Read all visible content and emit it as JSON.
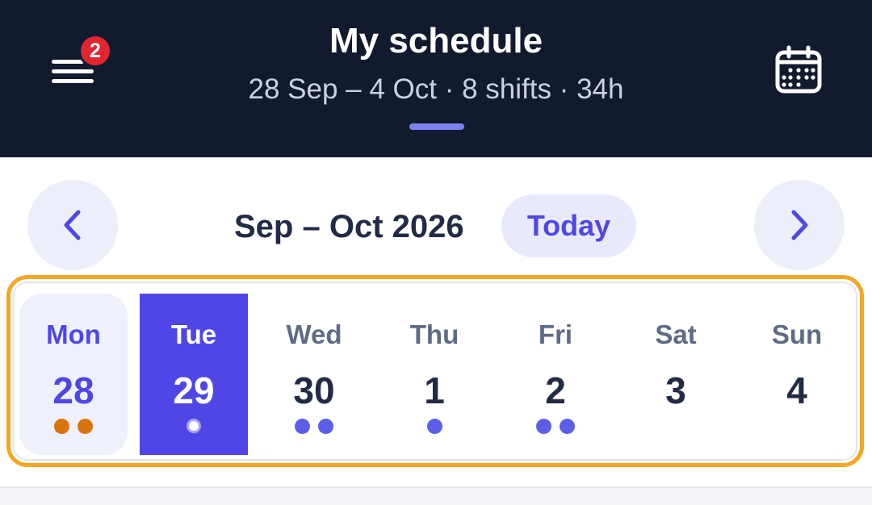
{
  "header": {
    "title": "My schedule",
    "subtitle": "28 Sep – 4 Oct · 8 shifts · 34h",
    "menu_icon": "menu-icon",
    "notification_count": "2",
    "calendar_icon": "calendar-icon"
  },
  "nav": {
    "month_label": "Sep – Oct 2026",
    "today_label": "Today",
    "prev_icon": "chevron-left-icon",
    "next_icon": "chevron-right-icon"
  },
  "week": {
    "days": [
      {
        "name": "Mon",
        "date": "28",
        "state": "today",
        "dots": [
          "amber",
          "amber"
        ]
      },
      {
        "name": "Tue",
        "date": "29",
        "state": "selected",
        "dots": [
          "white"
        ]
      },
      {
        "name": "Wed",
        "date": "30",
        "state": "normal",
        "dots": [
          "blue",
          "blue"
        ]
      },
      {
        "name": "Thu",
        "date": "1",
        "state": "normal",
        "dots": [
          "blue"
        ]
      },
      {
        "name": "Fri",
        "date": "2",
        "state": "normal",
        "dots": [
          "blue",
          "blue"
        ]
      },
      {
        "name": "Sat",
        "date": "3",
        "state": "normal",
        "dots": []
      },
      {
        "name": "Sun",
        "date": "4",
        "state": "normal",
        "dots": []
      }
    ]
  },
  "colors": {
    "header_bg": "#121a2e",
    "accent": "#4f46e5",
    "highlight_border": "#f5a623",
    "badge": "#e0262f",
    "dot_amber": "#d9730d",
    "dot_blue": "#5b5fe8"
  }
}
